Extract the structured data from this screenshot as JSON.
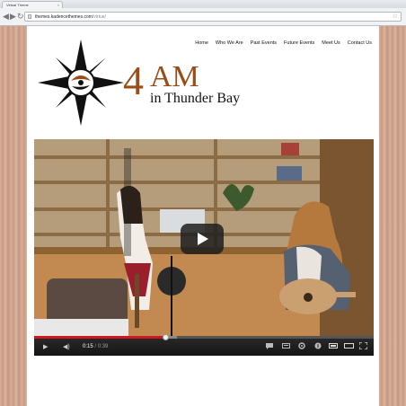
{
  "browser": {
    "tab_title": "Virtual Theme",
    "tab_close": "×",
    "url_domain": "themes.kadencethemes.com",
    "url_path": "/virtue/",
    "back_glyph": "◀",
    "forward_glyph": "▶",
    "reload_glyph": "↻",
    "star_glyph": "☆"
  },
  "nav": {
    "items": [
      "Home",
      "Who We Are",
      "Past Events",
      "Future Events",
      "Meet Us",
      "Contact Us"
    ]
  },
  "logo": {
    "numeral": "4",
    "am": "AM",
    "subtitle": "in Thunder Bay"
  },
  "video": {
    "current_time": "0:15",
    "separator": " / ",
    "duration": "0:39",
    "progress_fraction": 0.385,
    "loaded_fraction": 0.42,
    "play_glyph": "▶",
    "volume_glyph": "◀)",
    "icons": [
      "captions-icon",
      "subtitles-icon",
      "settings-icon",
      "youtube-info-icon",
      "small-player-icon",
      "theater-icon",
      "fullscreen-icon"
    ]
  },
  "colors": {
    "brand_brown": "#9a4d17",
    "progress_red": "#cc181e"
  }
}
